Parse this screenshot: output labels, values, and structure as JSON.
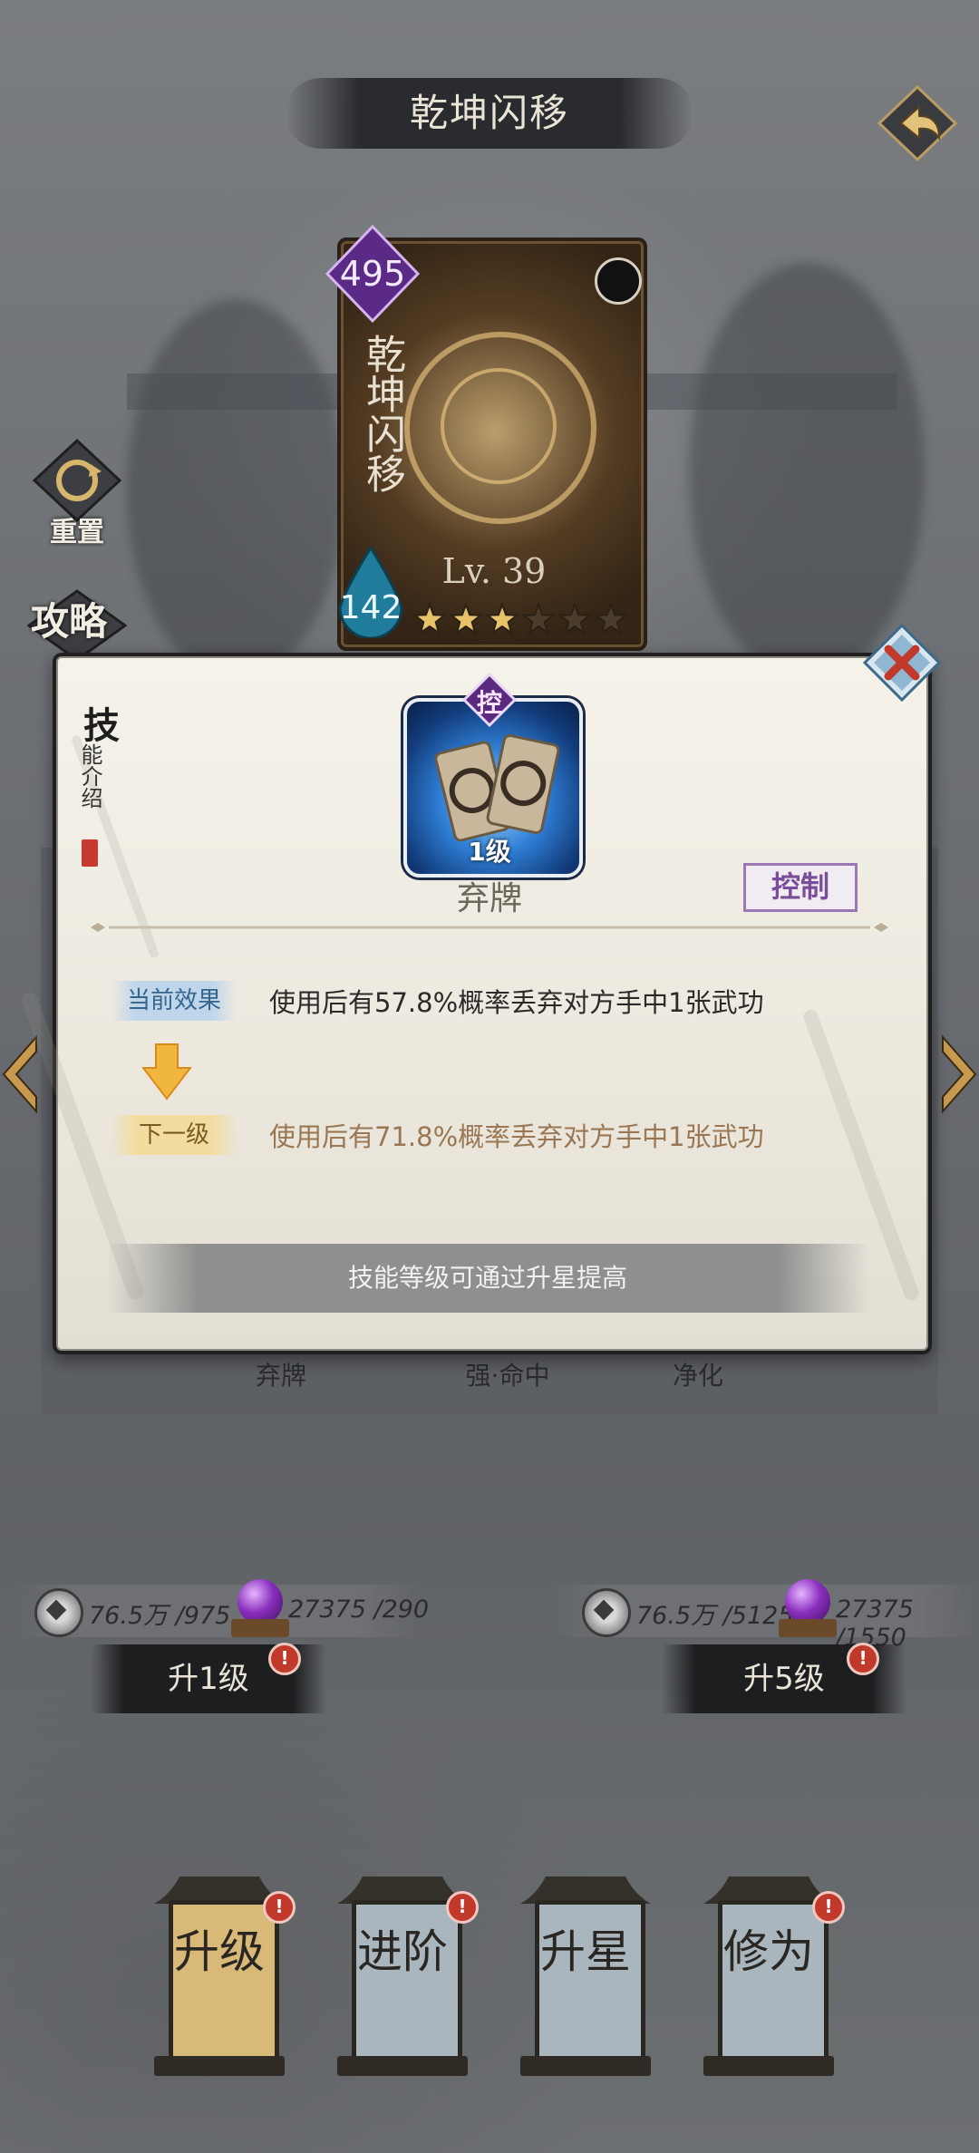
{
  "screen": {
    "title": "乾坤闪移",
    "back_icon": "back-arrow-icon"
  },
  "card": {
    "cost": "495",
    "name": "乾坤闪移",
    "level": "Lv. 39",
    "power": "142",
    "stars_filled": 3,
    "stars_total": 6
  },
  "side": {
    "reset_label": "重置",
    "strategy_label": "攻略"
  },
  "underlying_skills": [
    "弃牌",
    "强·命中",
    "净化"
  ],
  "popup": {
    "intro_big": "技",
    "intro_small": "能介绍",
    "skill_type_badge": "控",
    "skill_level": "1级",
    "skill_name": "弃牌",
    "skill_tag": "控制",
    "current_label": "当前效果",
    "current_effect": "使用后有57.8%概率丢弃对方手中1张武功",
    "next_label": "下一级",
    "next_effect": "使用后有71.8%概率丢弃对方手中1张武功",
    "hint": "技能等级可通过升星提高"
  },
  "upgrade": {
    "left": {
      "coin_cost": "76.5万 /975",
      "orb_cost": "27375 /290",
      "button": "升1级",
      "alert": "!"
    },
    "right": {
      "coin_cost": "76.5万 /5125",
      "orb_cost": "27375 /1550",
      "button": "升5级",
      "alert": "!"
    }
  },
  "tabs": [
    {
      "label": "升级",
      "active": true,
      "alert": "!"
    },
    {
      "label": "进阶",
      "active": false,
      "alert": "!"
    },
    {
      "label": "升星",
      "active": false,
      "alert": ""
    },
    {
      "label": "修为",
      "active": false,
      "alert": "!"
    }
  ],
  "colors": {
    "accent_gold": "#e7c36a",
    "alert_red": "#c0392b",
    "control_purple": "#7b4e9b"
  }
}
